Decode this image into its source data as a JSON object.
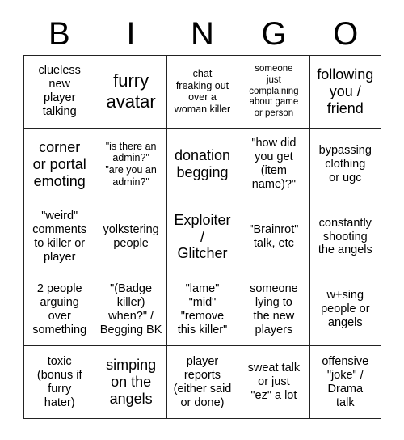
{
  "card": {
    "title": "BINGO",
    "header_letters": [
      "B",
      "I",
      "N",
      "G",
      "O"
    ],
    "background_color": "#ffffff",
    "border_color": "#222222",
    "text_color": "#000000",
    "rows": [
      [
        {
          "text": "clueless\nnew\nplayer\ntalking",
          "size": "md"
        },
        {
          "text": "furry\navatar",
          "size": "xl"
        },
        {
          "text": "chat\nfreaking out\nover a\nwoman killer",
          "size": "sm"
        },
        {
          "text": "someone\njust\ncomplaining\nabout game\nor person",
          "size": "xs"
        },
        {
          "text": "following\nyou /\nfriend",
          "size": "lg"
        }
      ],
      [
        {
          "text": "corner\nor portal\nemoting",
          "size": "lg"
        },
        {
          "text": "\"is there an\nadmin?\"\n\"are you an\nadmin?\"",
          "size": "sm"
        },
        {
          "text": "donation\nbegging",
          "size": "lg"
        },
        {
          "text": "\"how did\nyou get\n(item\nname)?\"",
          "size": "md"
        },
        {
          "text": "bypassing\nclothing\nor ugc",
          "size": "md"
        }
      ],
      [
        {
          "text": "\"weird\"\ncomments\nto killer or\nplayer",
          "size": "md"
        },
        {
          "text": "yolkstering\npeople",
          "size": "md"
        },
        {
          "text": "Exploiter\n/\nGlitcher",
          "size": "lg"
        },
        {
          "text": "\"Brainrot\"\ntalk, etc",
          "size": "md"
        },
        {
          "text": "constantly\nshooting\nthe angels",
          "size": "md"
        }
      ],
      [
        {
          "text": "2 people\narguing\nover\nsomething",
          "size": "md"
        },
        {
          "text": "\"(Badge\nkiller)\nwhen?\" /\nBegging BK",
          "size": "md"
        },
        {
          "text": "\"lame\"\n\"mid\"\n\"remove\nthis killer\"",
          "size": "md"
        },
        {
          "text": "someone\nlying to\nthe new\nplayers",
          "size": "md"
        },
        {
          "text": "w+sing\npeople or\nangels",
          "size": "md"
        }
      ],
      [
        {
          "text": "toxic\n(bonus if\nfurry\nhater)",
          "size": "md"
        },
        {
          "text": "simping\non the\nangels",
          "size": "lg"
        },
        {
          "text": "player\nreports\n(either said\nor done)",
          "size": "md"
        },
        {
          "text": "sweat talk\nor just\n\"ez\" a lot",
          "size": "md"
        },
        {
          "text": "offensive\n\"joke\" /\nDrama\ntalk",
          "size": "md"
        }
      ]
    ]
  }
}
